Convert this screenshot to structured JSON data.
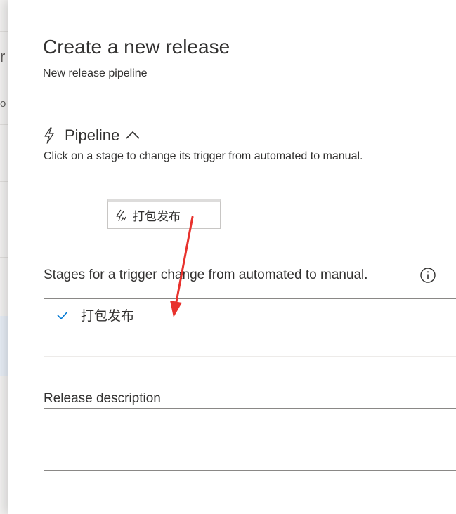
{
  "background": {
    "letters": [
      "r",
      "o"
    ]
  },
  "panel": {
    "title": "Create a new release",
    "subtitle": "New release pipeline"
  },
  "pipeline": {
    "label": "Pipeline",
    "hint": "Click on a stage to change its trigger from automated to manual.",
    "stage": {
      "name": "打包发布",
      "icon": "manual-trigger-icon"
    }
  },
  "stages_trigger": {
    "label": "Stages for a trigger change from automated to manual.",
    "selected": "打包发布",
    "info_icon": "info-icon"
  },
  "release_description": {
    "label": "Release description",
    "value": ""
  },
  "colors": {
    "accent": "#0078d4",
    "annotation": "#e8322d"
  }
}
